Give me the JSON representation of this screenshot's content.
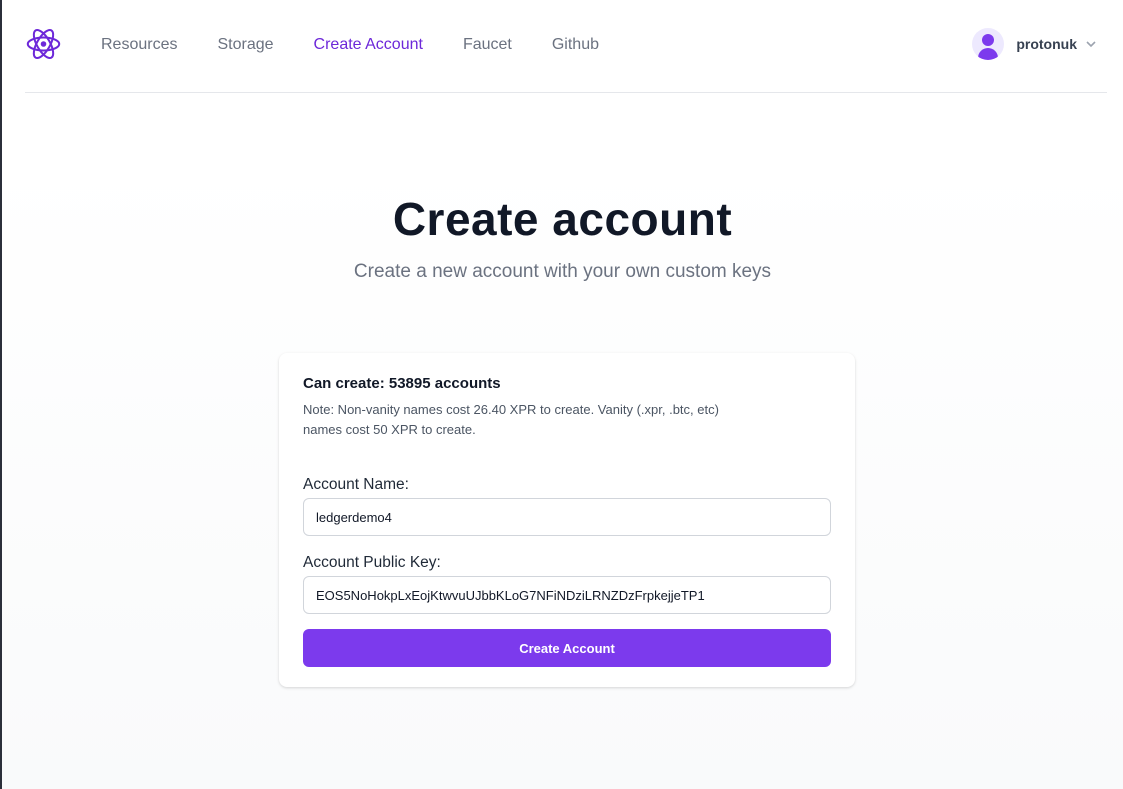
{
  "header": {
    "logo_icon": "atom-icon",
    "nav": [
      {
        "label": "Resources",
        "active": false
      },
      {
        "label": "Storage",
        "active": false
      },
      {
        "label": "Create Account",
        "active": true
      },
      {
        "label": "Faucet",
        "active": false
      },
      {
        "label": "Github",
        "active": false
      }
    ],
    "user": {
      "name": "protonuk",
      "avatar_icon": "user-icon",
      "menu_icon": "chevron-down-icon"
    }
  },
  "page": {
    "title": "Create account",
    "subtitle": "Create a new account with your own custom keys"
  },
  "form": {
    "can_create": "Can create: 53895 accounts",
    "note": "Note: Non-vanity names cost 26.40 XPR to create. Vanity (.xpr, .btc, etc) names cost 50 XPR to create.",
    "account_name_label": "Account Name:",
    "account_name_value": "ledgerdemo4",
    "public_key_label": "Account Public Key:",
    "public_key_value": "EOS5NoHokpLxEojKtwvuUJbbKLoG7NFiNDziLRNZDzFrpkejjeTP1",
    "submit_label": "Create Account"
  },
  "colors": {
    "accent": "#7c3aed",
    "active_nav": "#6d28d9",
    "title": "#111827",
    "muted": "#6b7280"
  }
}
